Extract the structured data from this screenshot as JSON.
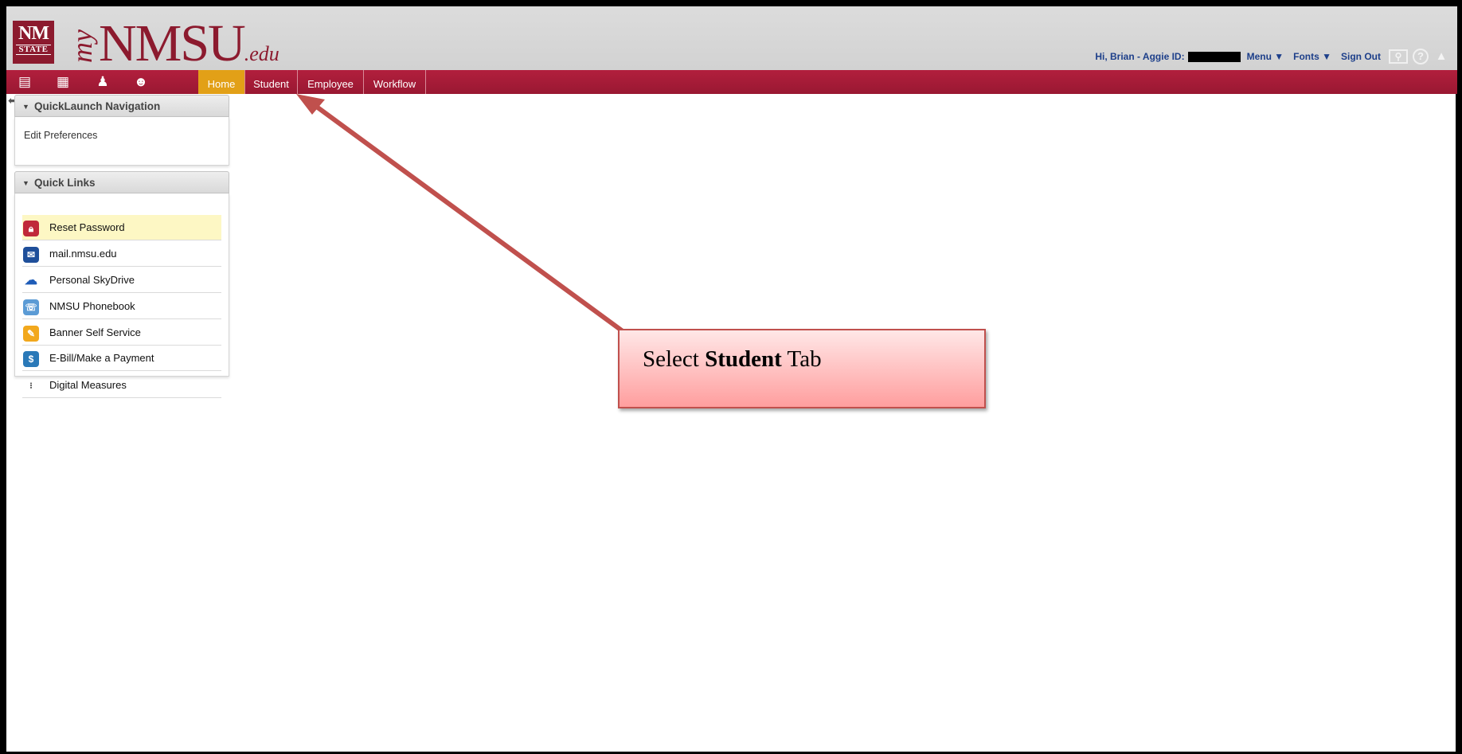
{
  "header": {
    "seal_line1": "NM",
    "seal_line2": "STATE",
    "brand_prefix": "my",
    "brand_name": "NMSU",
    "brand_suffix": ".edu",
    "greeting": "Hi, Brian - Aggie ID:",
    "menu_label": "Menu ▼",
    "fonts_label": "Fonts ▼",
    "sign_out_label": "Sign Out",
    "brand_color": "#8c1a2e"
  },
  "nav": {
    "icons": [
      "inbox-icon",
      "calendar-icon",
      "people-icon",
      "group-icon"
    ],
    "tabs": [
      {
        "label": "Home",
        "active": true
      },
      {
        "label": "Student",
        "active": false
      },
      {
        "label": "Employee",
        "active": false
      },
      {
        "label": "Workflow",
        "active": false
      }
    ],
    "bar_color": "#a81c38",
    "active_color": "#e2a017"
  },
  "sidebar": {
    "quicklaunch_title": "QuickLaunch Navigation",
    "edit_preferences": "Edit Preferences",
    "quick_links_title": "Quick Links",
    "quick_links": [
      {
        "label": "Reset Password",
        "icon": "lock-icon",
        "highlighted": true
      },
      {
        "label": "mail.nmsu.edu",
        "icon": "mail-icon",
        "highlighted": false
      },
      {
        "label": "Personal SkyDrive",
        "icon": "cloud-icon",
        "highlighted": false
      },
      {
        "label": "NMSU Phonebook",
        "icon": "phone-icon",
        "highlighted": false
      },
      {
        "label": "Banner Self Service",
        "icon": "wrench-icon",
        "highlighted": false
      },
      {
        "label": "E-Bill/Make a Payment",
        "icon": "payment-icon",
        "highlighted": false
      },
      {
        "label": "Digital Measures",
        "icon": "chart-dots-icon",
        "highlighted": false
      }
    ]
  },
  "annotation": {
    "prefix": "Select",
    "bold": "Student",
    "suffix": "Tab"
  }
}
